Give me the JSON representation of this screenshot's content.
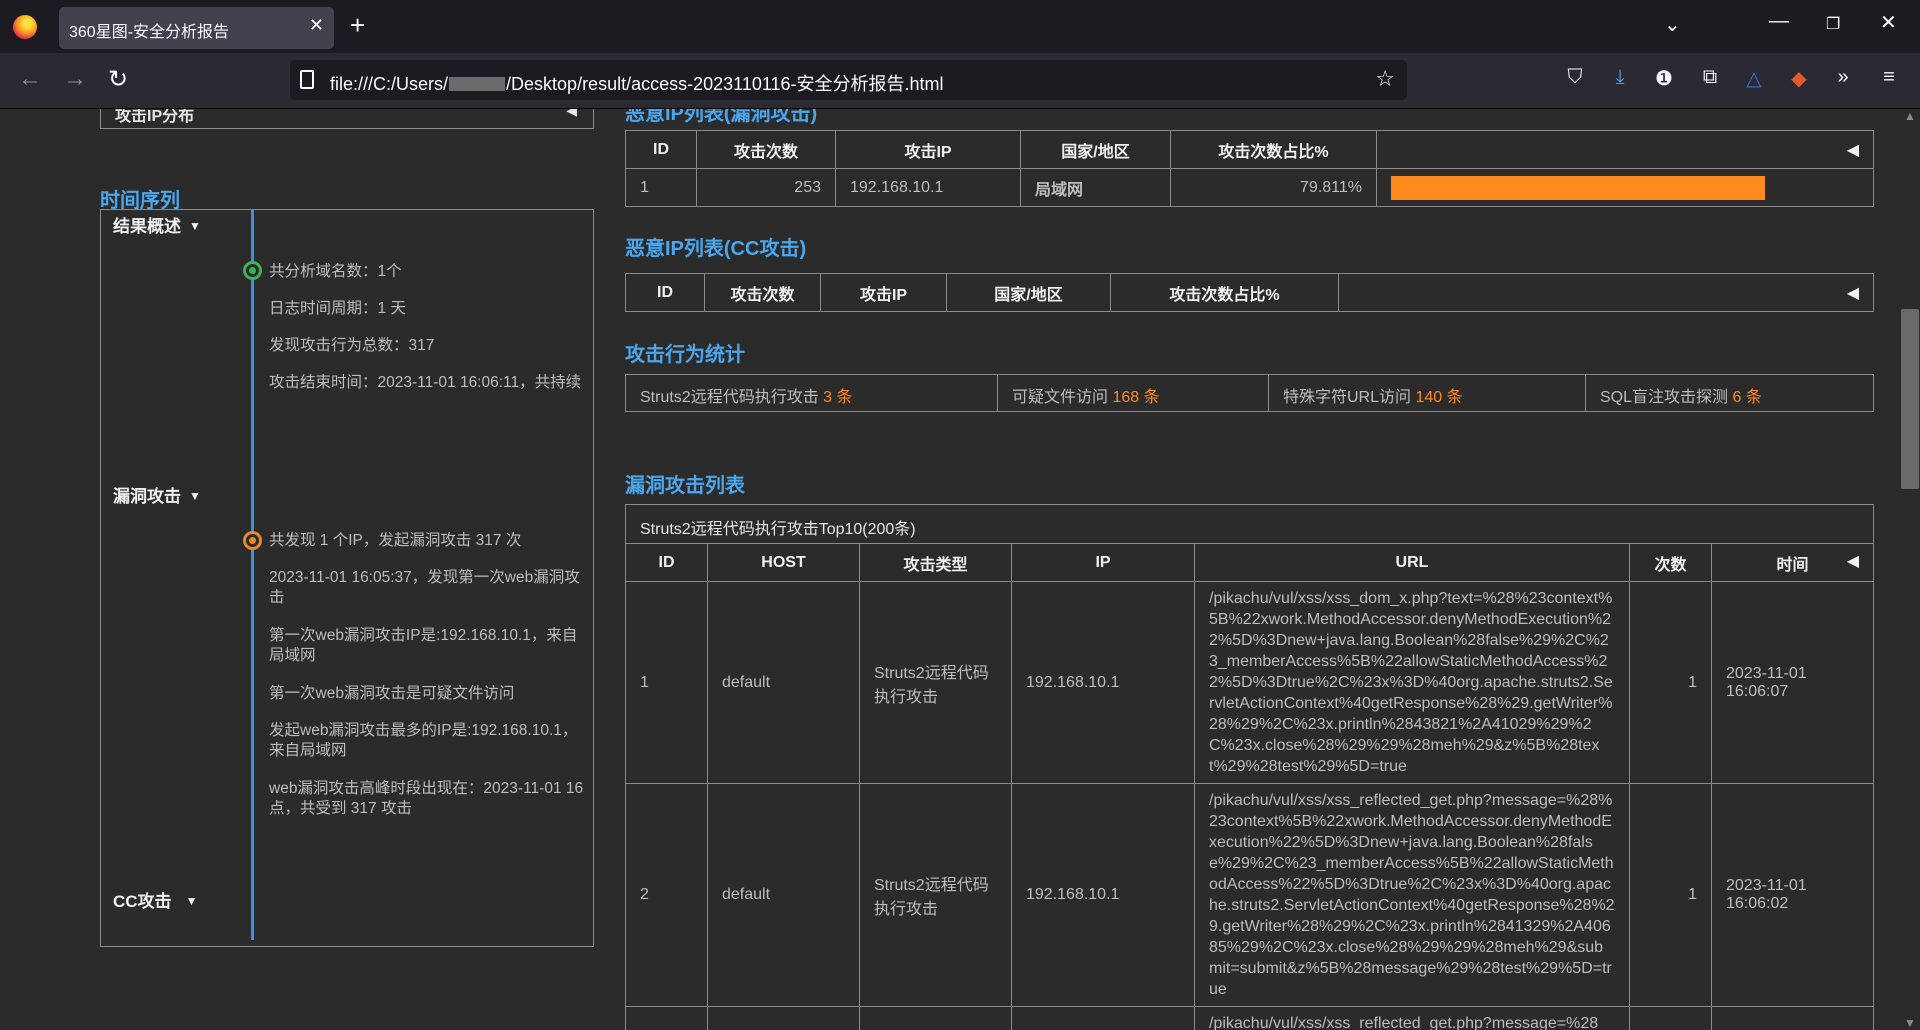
{
  "browser": {
    "tab_title": "360星图-安全分析报告",
    "url_prefix": "file:///C:/Users/",
    "url_suffix": "/Desktop/result/access-2023110116-安全分析报告.html"
  },
  "left": {
    "top_box_label": "攻击IP分布",
    "timeseries_heading": "时间序列",
    "sections": [
      {
        "title": "结果概述",
        "items": [
          "共分析域名数：1个",
          "日志时间周期：1 天",
          "发现攻击行为总数：317",
          "攻击结束时间：2023-11-01 16:06:11，共持续"
        ]
      },
      {
        "title": "漏洞攻击",
        "items": [
          "共发现 1 个IP，发起漏洞攻击 317 次",
          "2023-11-01 16:05:37，发现第一次web漏洞攻击",
          "第一次web漏洞攻击IP是:192.168.10.1，来自局域网",
          "第一次web漏洞攻击是可疑文件访问",
          "发起web漏洞攻击最多的IP是:192.168.10.1，来自局域网",
          "web漏洞攻击高峰时段出现在：2023-11-01 16点，共受到 317 攻击"
        ]
      },
      {
        "title": "CC攻击",
        "items": []
      }
    ]
  },
  "vuln_ip_table": {
    "heading": "恶意IP列表(漏洞攻击)",
    "headers": [
      "ID",
      "攻击次数",
      "攻击IP",
      "国家/地区",
      "攻击次数占比%"
    ],
    "rows": [
      {
        "id": "1",
        "count": "253",
        "ip": "192.168.10.1",
        "region": "局域网",
        "pct": "79.811%",
        "ratio": 0.79811
      }
    ]
  },
  "cc_ip_table": {
    "heading": "恶意IP列表(CC攻击)",
    "headers": [
      "ID",
      "攻击次数",
      "攻击IP",
      "国家/地区",
      "攻击次数占比%"
    ]
  },
  "stats": {
    "heading": "攻击行为统计",
    "items": [
      {
        "label": "Struts2远程代码执行攻击",
        "count": "3 条"
      },
      {
        "label": "可疑文件访问",
        "count": "168 条"
      },
      {
        "label": "特殊字符URL访问",
        "count": "140 条"
      },
      {
        "label": "SQL盲注攻击探测",
        "count": "6 条"
      }
    ]
  },
  "vuln_list": {
    "heading": "漏洞攻击列表",
    "caption": "Struts2远程代码执行攻击Top10(200条)",
    "headers": [
      "ID",
      "HOST",
      "攻击类型",
      "IP",
      "URL",
      "次数",
      "时间"
    ],
    "rows": [
      {
        "id": "1",
        "host": "default",
        "type": "Struts2远程代码执行攻击",
        "ip": "192.168.10.1",
        "url": "/pikachu/vul/xss/xss_dom_x.php?text=%28%23context%5B%22xwork.MethodAccessor.denyMethodExecution%22%5D%3Dnew+java.lang.Boolean%28false%29%2C%23_memberAccess%5B%22allowStaticMethodAccess%22%5D%3Dtrue%2C%23x%3D%40org.apache.struts2.ServletActionContext%40getResponse%28%29.getWriter%28%29%2C%23x.println%2843821%2A41029%29%2C%23x.close%28%29%29%28meh%29&z%5B%28text%29%28test%29%5D=true",
        "count": "1",
        "time": "2023-11-01 16:06:07"
      },
      {
        "id": "2",
        "host": "default",
        "type": "Struts2远程代码执行攻击",
        "ip": "192.168.10.1",
        "url": "/pikachu/vul/xss/xss_reflected_get.php?message=%28%23context%5B%22xwork.MethodAccessor.denyMethodExecution%22%5D%3Dnew+java.lang.Boolean%28false%29%2C%23_memberAccess%5B%22allowStaticMethodAccess%22%5D%3Dtrue%2C%23x%3D%40org.apache.struts2.ServletActionContext%40getResponse%28%29.getWriter%28%29%2C%23x.println%2841329%2A40685%29%2C%23x.close%28%29%29%28meh%29&submit=submit&z%5B%28message%29%28test%29%5D=true",
        "count": "1",
        "time": "2023-11-01 16:06:02"
      },
      {
        "id": "",
        "host": "",
        "type": "",
        "ip": "",
        "url": "/pikachu/vul/xss/xss_reflected_get.php?message=%28",
        "count": "",
        "time": ""
      }
    ]
  }
}
